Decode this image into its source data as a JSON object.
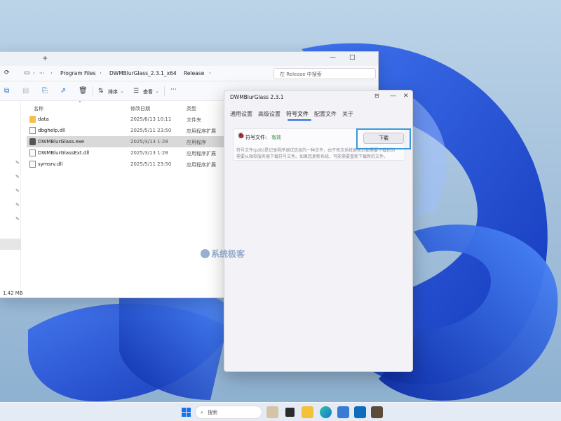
{
  "explorer": {
    "window_controls": [
      "—",
      "□"
    ],
    "tab_add": "+",
    "nav_icons": [
      "refresh-icon",
      "monitor-icon",
      "more-icon"
    ],
    "breadcrumbs": [
      "Program Files",
      "DWMBlurGlass_2.3.1_x64",
      "Release"
    ],
    "more_glyph": "···",
    "search_placeholder": "在 Release 中搜索",
    "toolbar": {
      "sort_label": "排序",
      "view_label": "查看",
      "more_label": "···"
    },
    "columns": {
      "name": "名称",
      "date": "修改日期",
      "type": "类型"
    },
    "files": [
      {
        "name": "data",
        "date": "2025/6/13 10:11",
        "type": "文件夹",
        "icon": "folder-icon",
        "selected": false
      },
      {
        "name": "dbghelp.dll",
        "date": "2025/5/11 23:50",
        "type": "应用程序扩展",
        "icon": "dll-icon",
        "selected": false
      },
      {
        "name": "DWMBlurGlass.exe",
        "date": "2025/3/13 1:28",
        "type": "应用程序",
        "icon": "exe-icon",
        "selected": true
      },
      {
        "name": "DWMBlurGlassExt.dll",
        "date": "2025/3/13 1:28",
        "type": "应用程序扩展",
        "icon": "dll-icon",
        "selected": false
      },
      {
        "name": "symsrv.dll",
        "date": "2025/5/11 23:50",
        "type": "应用程序扩展",
        "icon": "dll-icon",
        "selected": false
      }
    ],
    "status_size": "1.42 MB"
  },
  "dwm": {
    "title": "DWMBlurGlass 2.3.1",
    "window_controls": [
      "—",
      "□",
      "✕"
    ],
    "tabs": [
      {
        "label": "通用设置",
        "active": false
      },
      {
        "label": "高级设置",
        "active": false
      },
      {
        "label": "符号文件",
        "active": true
      },
      {
        "label": "配置文件",
        "active": false
      },
      {
        "label": "关于",
        "active": false
      }
    ],
    "symbol_label": "符号文件:",
    "symbol_status": "有效",
    "description_line1": "符号文件(pdb)是记录程序调试信息的一种文件，由于每次系统更新后都需要下载新的",
    "description_line2": "需要从微软服务器下载符号文件。如果您更新系统，可能需要重新下载新的文件。",
    "download_label": "下载",
    "colors": {
      "accent": "#2f6fd6",
      "status_ok": "#1e8c2e",
      "highlight": "#3a9ad9"
    }
  },
  "watermark": "系统极客",
  "taskbar": {
    "search_label": "搜索",
    "apps": [
      "windows-start-icon",
      "search-icon",
      "widget-icon",
      "taskview-icon",
      "file-explorer-icon",
      "edge-icon",
      "store-icon",
      "outlook-icon",
      "app-icon"
    ]
  }
}
